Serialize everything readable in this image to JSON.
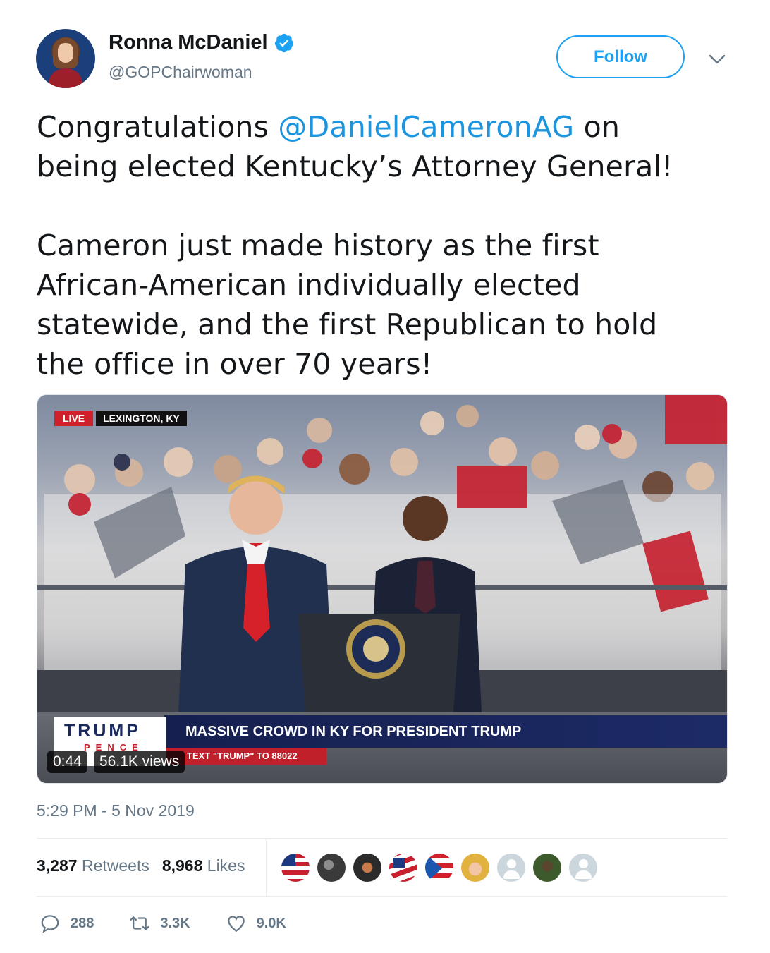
{
  "author": {
    "name": "Ronna McDaniel",
    "handle": "@GOPChairwoman",
    "verified": true
  },
  "follow_label": "Follow",
  "tweet": {
    "lines_p1": [
      "Congratulations ",
      "@DanielCameronAG",
      " on",
      "being elected Kentucky’s Attorney General!"
    ],
    "lines_p2": [
      "Cameron just made history as the first",
      "African-American individually elected",
      "statewide, and the first Republican to hold",
      "the office in over 70 years!"
    ]
  },
  "video": {
    "live_label": "LIVE",
    "location": "LEXINGTON, KY",
    "headline": "MASSIVE CROWD IN KY FOR PRESIDENT TRUMP",
    "subline": "TEXT \"TRUMP\" TO 88022",
    "logo_top": "TRUMP",
    "logo_bottom": "PENCE",
    "duration": "0:44",
    "views": "56.1K views"
  },
  "timestamp": "5:29 PM - 5 Nov 2019",
  "stats": {
    "retweets_count": "3,287",
    "retweets_label": "Retweets",
    "likes_count": "8,968",
    "likes_label": "Likes"
  },
  "actions": {
    "replies": "288",
    "retweets": "3.3K",
    "likes": "9.0K"
  },
  "colors": {
    "accent": "#1da1f2",
    "mention": "#1b95e0",
    "muted": "#657786"
  },
  "icons": [
    "verified-badge-icon",
    "chevron-down-icon",
    "reply-icon",
    "retweet-icon",
    "heart-icon"
  ]
}
